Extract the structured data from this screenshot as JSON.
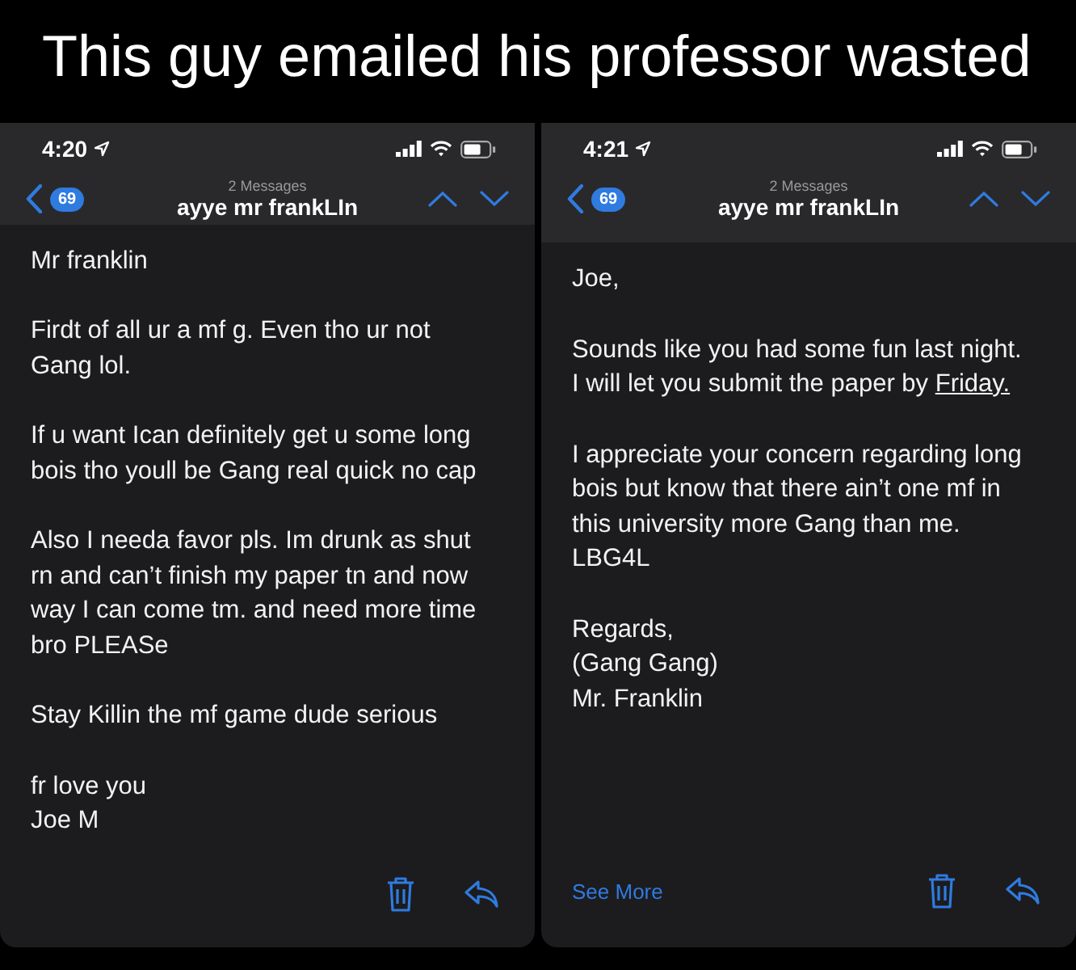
{
  "caption": "This guy emailed his professor wasted",
  "phones": [
    {
      "time": "4:20",
      "badge": "69",
      "count_label": "2 Messages",
      "subject": "ayye mr frankLIn",
      "paragraphs": [
        {
          "lines": [
            "Mr franklin"
          ]
        },
        {
          "lines": [
            "Firdt of all ur a mf g. Even tho ur not",
            "Gang lol."
          ]
        },
        {
          "lines": [
            "If u want Ican definitely get u some long",
            "bois tho youll be Gang real quick no cap"
          ]
        },
        {
          "lines": [
            "Also I needa favor pls. Im drunk as shut",
            "rn and can’t finish my paper tn and now",
            "way I can come tm. and need more time",
            "bro PLEASe"
          ]
        },
        {
          "lines": [
            "Stay Killin the mf game dude serious"
          ]
        },
        {
          "lines": [
            "fr love you",
            "Joe M"
          ]
        }
      ]
    },
    {
      "time": "4:21",
      "badge": "69",
      "count_label": "2 Messages",
      "subject": "ayye mr frankLIn",
      "see_more": "See More",
      "paragraphs": [
        {
          "lines": [
            "Joe,"
          ]
        },
        {
          "lines": [
            "Sounds like you had some fun last night.",
            "I will let you submit the paper by "
          ],
          "link": "Friday."
        },
        {
          "lines": [
            "I appreciate your concern regarding long",
            "bois but know that there ain’t one mf in",
            "this university more Gang than me.",
            "LBG4L"
          ]
        },
        {
          "lines": [
            "Regards,",
            "(Gang Gang)",
            "Mr. Franklin"
          ]
        }
      ]
    }
  ]
}
